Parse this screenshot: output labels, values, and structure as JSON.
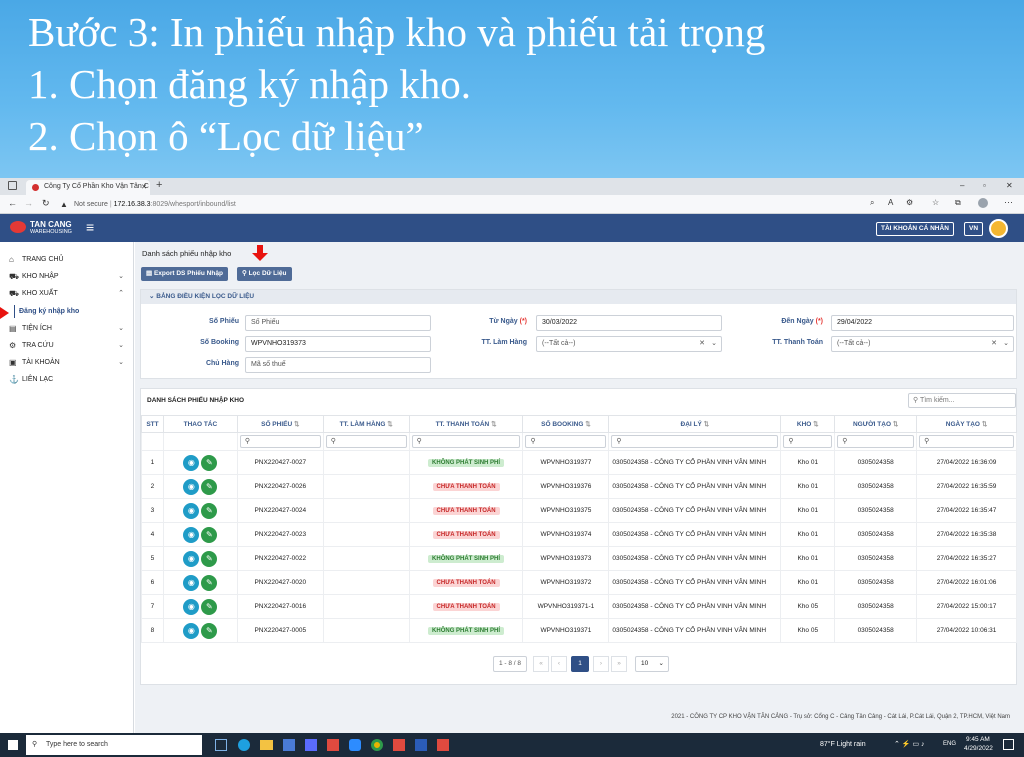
{
  "slide": {
    "line1": "Bước 3: In phiếu nhập kho và phiếu tải trọng",
    "line2": "1. Chọn đăng ký nhập kho.",
    "line3": "2. Chọn ô “Lọc dữ liệu”"
  },
  "browser": {
    "tab_title": "Công Ty Cổ Phần Kho Vận Tân C",
    "not_secure": "Not secure",
    "url_host": "172.16.38.3",
    "url_path": ":8029/whesport/inbound/list"
  },
  "header": {
    "logo_line1": "TAN CANG",
    "logo_line2": "WAREHOUSING",
    "account": "TÀI KHOẢN CÁ NHÂN",
    "lang": "VN"
  },
  "sidebar": {
    "items": [
      {
        "label": "TRANG CHỦ",
        "icon": "home-icon"
      },
      {
        "label": "KHO NHẬP",
        "icon": "cart-icon"
      },
      {
        "label": "KHO XUẤT",
        "icon": "cart-icon"
      },
      {
        "label": "Đăng ký nhập kho",
        "icon": ""
      },
      {
        "label": "TIỆN ÍCH",
        "icon": "utility-icon"
      },
      {
        "label": "TRA CỨU",
        "icon": "gear-icon"
      },
      {
        "label": "TÀI KHOẢN",
        "icon": "account-icon"
      },
      {
        "label": "LIÊN LẠC",
        "icon": "contact-icon"
      }
    ]
  },
  "page": {
    "title": "Danh sách phiếu nhập kho",
    "export_btn": "Export DS Phiếu Nhập",
    "filter_btn": "Lọc Dữ Liệu"
  },
  "filter": {
    "panel_title": "BẢNG ĐIỀU KIỆN LỌC DỮ LIỆU",
    "so_phieu_label": "Số Phiếu",
    "so_phieu_placeholder": "Số Phiếu",
    "so_booking_label": "Số Booking",
    "so_booking_value": "WPVNHO319373",
    "chu_hang_label": "Chủ Hàng",
    "chu_hang_placeholder": "Mã số thuế",
    "tu_ngay_label": "Từ Ngày",
    "tu_ngay_value": "30/03/2022",
    "tt_lam_hang_label": "TT. Làm Hàng",
    "tt_lam_hang_value": "(--Tất cả--)",
    "den_ngay_label": "Đến Ngày",
    "den_ngay_value": "29/04/2022",
    "tt_thanh_toan_label": "TT. Thanh Toán",
    "tt_thanh_toan_value": "(--Tất cả--)",
    "required": "(*)"
  },
  "table": {
    "title": "DANH SÁCH PHIẾU NHẬP KHO",
    "search_placeholder": "Tìm kiếm...",
    "columns": [
      "STT",
      "THAO TÁC",
      "SỐ PHIẾU",
      "TT. LÀM HÀNG",
      "TT. THANH TOÁN",
      "SỐ BOOKING",
      "ĐẠI LÝ",
      "KHO",
      "NGƯỜI TẠO",
      "NGÀY TẠO"
    ],
    "rows": [
      {
        "stt": "1",
        "so_phieu": "PNX220427-0027",
        "tt_thanh_toan": "KHÔNG PHÁT SINH PHÍ",
        "status": "green",
        "booking": "WPVNHO319377",
        "dai_ly": "0305024358 - CÔNG TY CỔ PHẦN VINH VÂN MINH",
        "kho": "Kho 01",
        "nguoi_tao": "0305024358",
        "ngay_tao": "27/04/2022 16:36:09"
      },
      {
        "stt": "2",
        "so_phieu": "PNX220427-0026",
        "tt_thanh_toan": "CHƯA THANH TOÁN",
        "status": "red",
        "booking": "WPVNHO319376",
        "dai_ly": "0305024358 - CÔNG TY CỔ PHẦN VINH VÂN MINH",
        "kho": "Kho 01",
        "nguoi_tao": "0305024358",
        "ngay_tao": "27/04/2022 16:35:59"
      },
      {
        "stt": "3",
        "so_phieu": "PNX220427-0024",
        "tt_thanh_toan": "CHƯA THANH TOÁN",
        "status": "red",
        "booking": "WPVNHO319375",
        "dai_ly": "0305024358 - CÔNG TY CỔ PHẦN VINH VÂN MINH",
        "kho": "Kho 01",
        "nguoi_tao": "0305024358",
        "ngay_tao": "27/04/2022 16:35:47"
      },
      {
        "stt": "4",
        "so_phieu": "PNX220427-0023",
        "tt_thanh_toan": "CHƯA THANH TOÁN",
        "status": "red",
        "booking": "WPVNHO319374",
        "dai_ly": "0305024358 - CÔNG TY CỔ PHẦN VINH VÂN MINH",
        "kho": "Kho 01",
        "nguoi_tao": "0305024358",
        "ngay_tao": "27/04/2022 16:35:38"
      },
      {
        "stt": "5",
        "so_phieu": "PNX220427-0022",
        "tt_thanh_toan": "KHÔNG PHÁT SINH PHÍ",
        "status": "green",
        "booking": "WPVNHO319373",
        "dai_ly": "0305024358 - CÔNG TY CỔ PHẦN VINH VÂN MINH",
        "kho": "Kho 01",
        "nguoi_tao": "0305024358",
        "ngay_tao": "27/04/2022 16:35:27"
      },
      {
        "stt": "6",
        "so_phieu": "PNX220427-0020",
        "tt_thanh_toan": "CHƯA THANH TOÁN",
        "status": "red",
        "booking": "WPVNHO319372",
        "dai_ly": "0305024358 - CÔNG TY CỔ PHẦN VINH VÂN MINH",
        "kho": "Kho 01",
        "nguoi_tao": "0305024358",
        "ngay_tao": "27/04/2022 16:01:06"
      },
      {
        "stt": "7",
        "so_phieu": "PNX220427-0016",
        "tt_thanh_toan": "CHƯA THANH TOÁN",
        "status": "red",
        "booking": "WPVNHO319371-1",
        "dai_ly": "0305024358 - CÔNG TY CỔ PHẦN VINH VÂN MINH",
        "kho": "Kho 05",
        "nguoi_tao": "0305024358",
        "ngay_tao": "27/04/2022 15:00:17"
      },
      {
        "stt": "8",
        "so_phieu": "PNX220427-0005",
        "tt_thanh_toan": "KHÔNG PHÁT SINH PHÍ",
        "status": "green",
        "booking": "WPVNHO319371",
        "dai_ly": "0305024358 - CÔNG TY CỔ PHẦN VINH VÂN MINH",
        "kho": "Kho 05",
        "nguoi_tao": "0305024358",
        "ngay_tao": "27/04/2022 10:06:31"
      }
    ]
  },
  "pager": {
    "range": "1 - 8 / 8",
    "current": "1",
    "page_size": "10"
  },
  "footer": "2021 - CÔNG TY CP KHO VẬN TÂN CẢNG - Trụ sở: Cổng C - Cảng Tân Cảng - Cát Lái, P.Cát Lái, Quận 2, TP.HCM, Việt Nam",
  "taskbar": {
    "search": "Type here to search",
    "weather": "87°F  Light rain",
    "lang": "ENG",
    "time": "9:45 AM",
    "date": "4/29/2022"
  },
  "colors": {
    "header": "#2f4f86",
    "accent": "#4f6b97",
    "banner": "#5fb6ee",
    "arrow": "#e8130f"
  }
}
